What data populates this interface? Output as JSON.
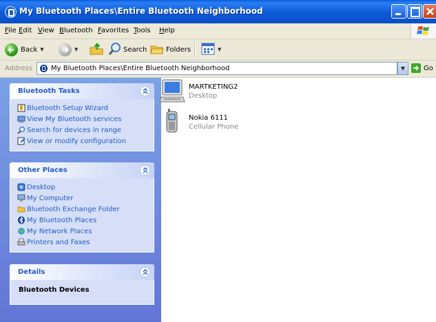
{
  "window": {
    "title": "My Bluetooth Places\\Entire Bluetooth Neighborhood"
  },
  "menu": [
    "File",
    "Edit",
    "View",
    "Bluetooth",
    "Favorites",
    "Tools",
    "Help"
  ],
  "toolbar": {
    "back": "Back",
    "search": "Search",
    "folders": "Folders"
  },
  "address": {
    "label": "Address",
    "value": "My Bluetooth Places\\Entire Bluetooth Neighborhood",
    "go": "Go"
  },
  "bluetooth_tasks": {
    "title": "Bluetooth Tasks",
    "items": [
      {
        "label": "Bluetooth Setup Wizard",
        "icon": "wizard-icon"
      },
      {
        "label": "View My Bluetooth services",
        "icon": "services-icon"
      },
      {
        "label": "Search for devices in range",
        "icon": "search-icon"
      },
      {
        "label": "View or modify configuration",
        "icon": "config-icon"
      }
    ]
  },
  "other_places": {
    "title": "Other Places",
    "items": [
      {
        "label": "Desktop",
        "icon": "desktop-icon"
      },
      {
        "label": "My Computer",
        "icon": "computer-icon"
      },
      {
        "label": "Bluetooth Exchange Folder",
        "icon": "folder-icon"
      },
      {
        "label": "My Bluetooth Places",
        "icon": "bluetooth-icon"
      },
      {
        "label": "My Network Places",
        "icon": "network-icon"
      },
      {
        "label": "Printers and Faxes",
        "icon": "printer-icon"
      }
    ]
  },
  "details": {
    "title": "Details",
    "text": "Bluetooth Devices"
  },
  "devices": [
    {
      "name": "MARTKETING2",
      "type": "Desktop",
      "icon": "desktop-computer-icon"
    },
    {
      "name": "Nokia 6111",
      "type": "Cellular Phone",
      "icon": "cellular-phone-icon"
    }
  ],
  "colors": {
    "titlebar": "#0a5ee0",
    "sidebar": "#7ba2e7",
    "link": "#215dc6",
    "panel_body": "#d6dff7"
  }
}
